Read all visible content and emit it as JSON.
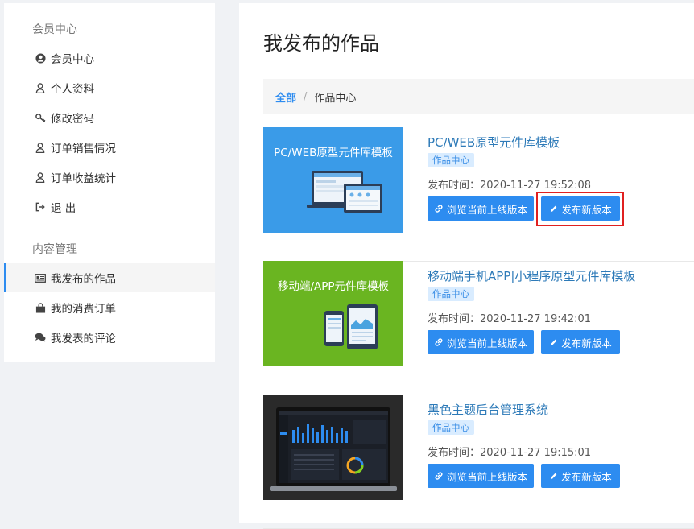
{
  "sidebar": {
    "section1": "会员中心",
    "section2": "内容管理",
    "items": [
      {
        "label": "会员中心",
        "icon": "user-circle-icon"
      },
      {
        "label": "个人资料",
        "icon": "user-icon"
      },
      {
        "label": "修改密码",
        "icon": "key-icon"
      },
      {
        "label": "订单销售情况",
        "icon": "user-icon"
      },
      {
        "label": "订单收益统计",
        "icon": "user-icon"
      },
      {
        "label": "退 出",
        "icon": "logout-icon"
      },
      {
        "label": "我发布的作品",
        "icon": "card-icon",
        "active": true
      },
      {
        "label": "我的消费订单",
        "icon": "bag-icon"
      },
      {
        "label": "我发表的评论",
        "icon": "comments-icon"
      }
    ]
  },
  "main": {
    "title": "我发布的作品",
    "breadcrumb": {
      "root": "全部",
      "sep": "/",
      "current": "作品中心"
    },
    "works": [
      {
        "thumb_text": "PC/WEB原型元件库模板",
        "thumb_color": "#3a9be8",
        "title": "PC/WEB原型元件库模板",
        "tag": "作品中心",
        "time": "发布时间：2020-11-27 19:52:08",
        "browse_label": "浏览当前上线版本",
        "publish_label": "发布新版本",
        "highlighted": true
      },
      {
        "thumb_text": "移动端/APP元件库模板",
        "thumb_color": "#6ab521",
        "title": "移动端手机APP|小程序原型元件库模板",
        "tag": "作品中心",
        "time": "发布时间：2020-11-27 19:42:01",
        "browse_label": "浏览当前上线版本",
        "publish_label": "发布新版本"
      },
      {
        "thumb_text": "",
        "thumb_color": "#2a2a2a",
        "title": "黑色主题后台管理系统",
        "tag": "作品中心",
        "time": "发布时间：2020-11-27 19:15:01",
        "browse_label": "浏览当前上线版本",
        "publish_label": "发布新版本"
      }
    ]
  },
  "colors": {
    "accent": "#2d8cf0",
    "highlight": "#e02020"
  }
}
